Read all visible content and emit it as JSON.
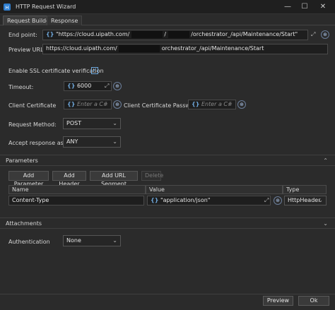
{
  "window": {
    "title": "HTTP Request Wizard",
    "minimize": "—",
    "maximize": "☐",
    "close": "✕"
  },
  "tabs": [
    {
      "label": "Request Builder"
    },
    {
      "label": "Response"
    }
  ],
  "endpoint": {
    "label": "End point:",
    "value_prefix": "\"https://cloud.uipath.com/",
    "value_mid": "/",
    "value_suffix": "/orchestrator_/api/Maintenance/Start\""
  },
  "preview_url": {
    "label": "Preview URL:",
    "value_prefix": "https://cloud.uipath.com/",
    "value_suffix": "orchestrator_/api/Maintenance/Start"
  },
  "ssl": {
    "label": "Enable SSL certificate verification",
    "checkmark": "✓"
  },
  "timeout": {
    "label": "Timeout:",
    "value": "6000"
  },
  "client_certificate": {
    "label": "Client Certificate",
    "placeholder": "Enter a C#"
  },
  "client_certificate_password": {
    "label": "Client Certificate Password",
    "placeholder": "Enter a C#"
  },
  "request_method": {
    "label": "Request Method:",
    "value": "POST"
  },
  "accept_response": {
    "label": "Accept response as:",
    "value": "ANY"
  },
  "parameters": {
    "section_label": "Parameters",
    "buttons": {
      "add_parameter": "Add Parameter",
      "add_header": "Add Header",
      "add_url_segment": "Add URL Segment",
      "delete": "Delete"
    },
    "columns": [
      "Name",
      "Value",
      "Type"
    ],
    "rows": [
      {
        "name": "Content-Type",
        "value": "\"application/json\"",
        "type": "HttpHeader"
      }
    ]
  },
  "attachments": {
    "section_label": "Attachments"
  },
  "authentication": {
    "label": "Authentication",
    "value": "None"
  },
  "footer": {
    "preview": "Preview",
    "ok": "Ok"
  },
  "icons": {
    "braces": "{}",
    "expand": "⤢",
    "plus_circle": "⊕",
    "chevron_down": "⌄",
    "chevron_up": "⌃"
  },
  "colors": {
    "background": "#2b2b2b",
    "accent": "#6fa8dc"
  }
}
